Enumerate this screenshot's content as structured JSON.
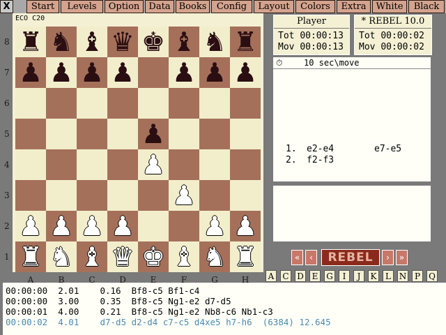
{
  "menu": {
    "close_label": "X",
    "items": [
      "Start",
      "Levels",
      "Option",
      "Data",
      "Books",
      "Config",
      "Layout",
      "Colors",
      "Extra",
      "White",
      "Black"
    ]
  },
  "opening": "ECO C20",
  "board": {
    "ranks": [
      "8",
      "7",
      "6",
      "5",
      "4",
      "3",
      "2",
      "1"
    ],
    "files": [
      "A",
      "B",
      "C",
      "D",
      "E",
      "F",
      "G",
      "H"
    ],
    "position": [
      [
        "r",
        "n",
        "b",
        "q",
        "k",
        "b",
        "n",
        "r"
      ],
      [
        "p",
        "p",
        "p",
        "p",
        "",
        "p",
        "p",
        "p"
      ],
      [
        "",
        "",
        "",
        "",
        "",
        "",
        "",
        ""
      ],
      [
        "",
        "",
        "",
        "",
        "p",
        "",
        "",
        ""
      ],
      [
        "",
        "",
        "",
        "",
        "P",
        "",
        "",
        ""
      ],
      [
        "",
        "",
        "",
        "",
        "",
        "P",
        "",
        ""
      ],
      [
        "P",
        "P",
        "P",
        "P",
        "",
        "",
        "P",
        "P"
      ],
      [
        "R",
        "N",
        "B",
        "Q",
        "K",
        "B",
        "N",
        "R"
      ]
    ]
  },
  "clocks": {
    "player": {
      "name": "Player",
      "tot_label": "Tot",
      "tot": "00:00:13",
      "mov_label": "Mov",
      "mov": "00:00:13"
    },
    "engine": {
      "name": "* REBEL 10.0",
      "tot_label": "Tot",
      "tot": "00:00:02",
      "mov_label": "Mov",
      "mov": "00:00:02"
    }
  },
  "notation": {
    "level": "10 sec\\move",
    "moves": [
      {
        "num": "1.",
        "white": "e2-e4",
        "black": "e7-e5"
      },
      {
        "num": "2.",
        "white": "f2-f3",
        "black": ""
      }
    ]
  },
  "nav": {
    "first": "«",
    "prev": "‹",
    "engine_label": "REBEL",
    "next": "›",
    "last": "»"
  },
  "file_buttons": [
    "A",
    "C",
    "D",
    "E",
    "G",
    "I",
    "J",
    "K",
    "L",
    "N",
    "P",
    "Q"
  ],
  "analysis": [
    {
      "time": "00:00:00",
      "depth": "2.01",
      "score": "0.16",
      "pv": "Bf8-c5 Bf1-c4"
    },
    {
      "time": "00:00:00",
      "depth": "3.00",
      "score": "0.35",
      "pv": "Bf8-c5 Ng1-e2 d7-d5"
    },
    {
      "time": "00:00:01",
      "depth": "4.00",
      "score": "0.21",
      "pv": "Bf8-c5 Ng1-e2 Nb8-c6 Nb1-c3"
    },
    {
      "time": "00:00:02",
      "depth": "4.01",
      "score": "",
      "pv": "d7-d5 d2-d4 c7-c5 d4xe5 h7-h6  (6384) 12.645"
    }
  ],
  "colors": {
    "light_square": "#f2eecc",
    "dark_square": "#a5705a",
    "menu_button": "#d4a38e",
    "engine_button": "#8a2a1a",
    "current_line": "#4a8ab0"
  }
}
